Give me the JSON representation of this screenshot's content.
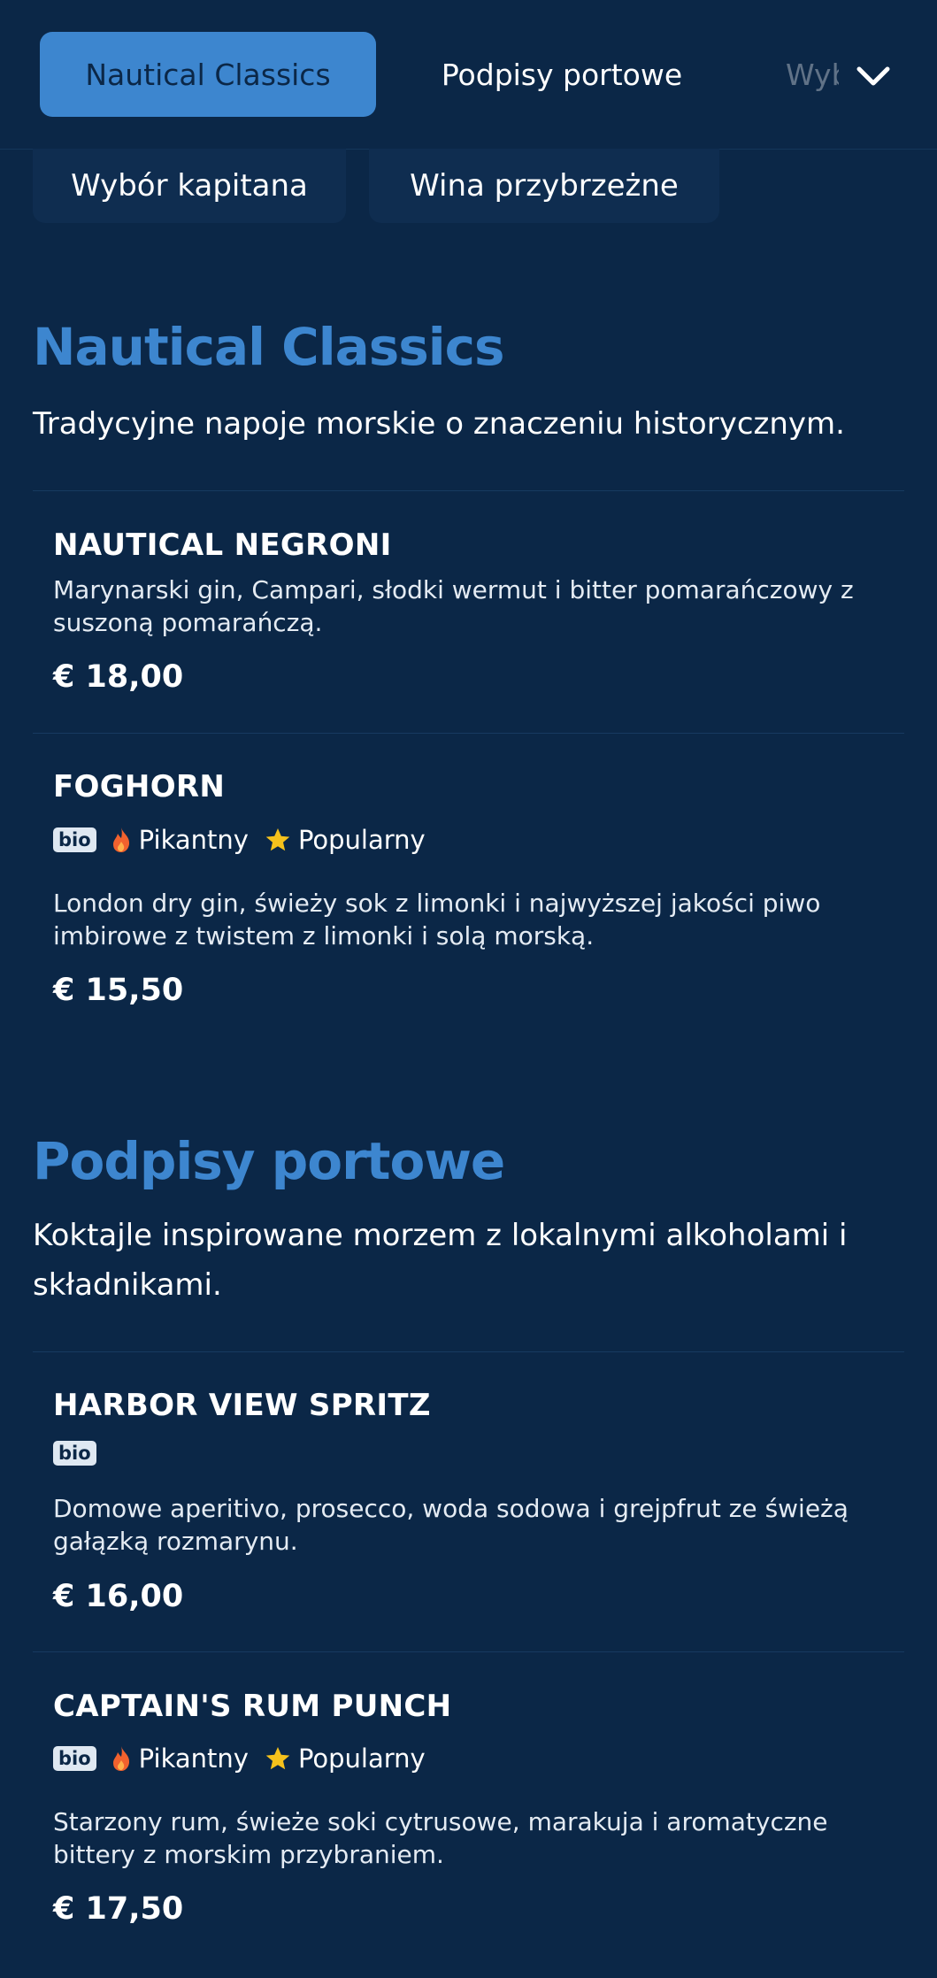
{
  "nav": {
    "tabs": [
      {
        "label": "Nautical Classics",
        "active": true
      },
      {
        "label": "Podpisy portowe"
      },
      {
        "label": "Wybór kapitana"
      }
    ],
    "overflow_tabs": [
      {
        "label": "Wybór kapitana"
      },
      {
        "label": "Wina przybrzeżne"
      }
    ]
  },
  "sections": [
    {
      "title": "Nautical Classics",
      "description": "Tradycyjne napoje morskie o znaczeniu historycznym.",
      "items": [
        {
          "name": "NAUTICAL NEGRONI",
          "description": "Marynarski gin, Campari, słodki wermut i bitter pomarańczowy z suszoną pomarańczą.",
          "price": "€ 18,00"
        },
        {
          "name": "FOGHORN",
          "tags": {
            "bio": "bio",
            "spicy": "Pikantny",
            "popular": "Popularny"
          },
          "description": "London dry gin, świeży sok z limonki i najwyższej jakości piwo imbirowe z twistem z limonki i solą morską.",
          "price": "€ 15,50"
        }
      ]
    },
    {
      "title": "Podpisy portowe",
      "description": "Koktajle inspirowane morzem z lokalnymi alkoholami i składnikami.",
      "items": [
        {
          "name": "HARBOR VIEW SPRITZ",
          "tags": {
            "bio": "bio"
          },
          "description": "Domowe aperitivo, prosecco, woda sodowa i grejpfrut ze świeżą gałązką rozmarynu.",
          "price": "€ 16,00"
        },
        {
          "name": "CAPTAIN'S RUM PUNCH",
          "tags": {
            "bio": "bio",
            "spicy": "Pikantny",
            "popular": "Popularny"
          },
          "description": "Starzony rum, świeże soki cytrusowe, marakuja i aromatyczne bittery z morskim przybraniem.",
          "price": "€ 17,50"
        }
      ]
    }
  ],
  "colors": {
    "background": "#0b2747",
    "accent": "#3d86cf",
    "flame": "#f2622e",
    "star": "#f6c21c"
  }
}
